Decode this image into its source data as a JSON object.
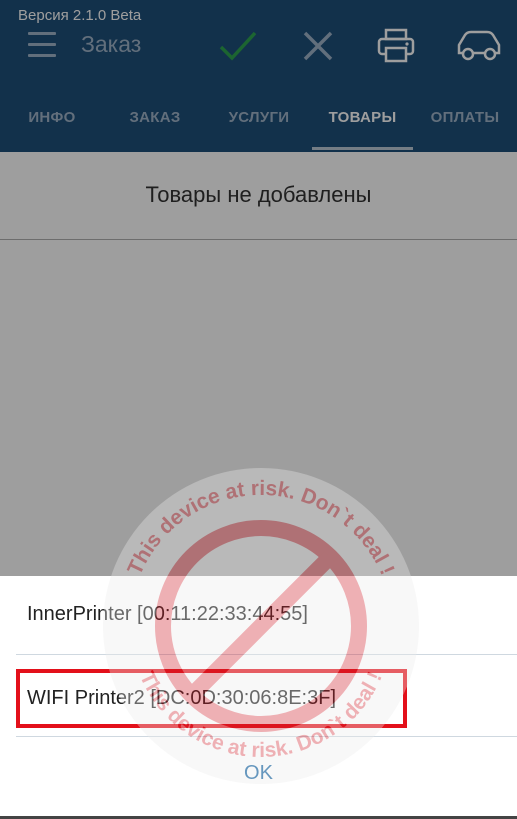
{
  "status": {
    "version": "Версия 2.1.0 Beta"
  },
  "header": {
    "title": "Заказ"
  },
  "icons": {
    "menu": "hamburger-menu-icon",
    "confirm": "checkmark-icon",
    "cancel": "close-icon",
    "print": "printer-icon",
    "delivery": "car-icon"
  },
  "tabs": [
    {
      "label": "ИНФО"
    },
    {
      "label": "ЗАКАЗ"
    },
    {
      "label": "УСЛУГИ"
    },
    {
      "label": "ТОВАРЫ",
      "active": true
    },
    {
      "label": "ОПЛАТЫ"
    }
  ],
  "content": {
    "empty_message": "Товары не добавлены"
  },
  "dialog": {
    "printers": [
      {
        "label": "InnerPrinter [00:11:22:33:44:55]"
      },
      {
        "label": "WIFI Printer2 [DC:0D:30:06:8E:3F]"
      }
    ],
    "ok_label": "OK"
  },
  "watermark": {
    "top_text": "This device at risk. Don`t deal !",
    "bottom_text": "This device at risk. Don`t deal !"
  },
  "colors": {
    "header_bg": "#1e4f79",
    "accent_green": "#2ea44f",
    "highlight_red": "#e3101a",
    "ok_blue": "#1e6aa6"
  }
}
